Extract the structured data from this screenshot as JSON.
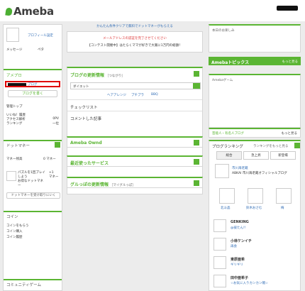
{
  "header": {
    "logo": "Ameba"
  },
  "left": {
    "profile_link": "プロフィール設定",
    "message_label": "メッセージ",
    "pega_label": "ペタ",
    "ameplo_head": "アメプロ",
    "blog_label": "ブログ",
    "write_blog_btn": "ブログを書く",
    "manage_top": "管理トップ",
    "stats": [
      {
        "label": "いいね！履歴",
        "value": ""
      },
      {
        "label": "アクセス解析",
        "value": "0PV"
      },
      {
        "label": "ランキング",
        "value": "一位"
      }
    ],
    "dotmoney_head": "ドットマネー",
    "money_owned_label": "マネー残高",
    "money_owned_value": "0 マネー",
    "puzzle_text": "パズルを1回プレイしよう\nお得なドットマネー",
    "puzzle_reward": "+1\nマネー",
    "money_receive_btn": "ドットマネーを受け取りにいく",
    "coin_head": "コイン",
    "coin_links": [
      "コインをもらう",
      "コイン購入",
      "コイン履歴"
    ],
    "community_head": "コミュニティゲーム"
  },
  "middle": {
    "promo_top": "かんたん条件クリアで無料でドットマネーがもらえる",
    "promo_red": "メールアドレスの認証を完了させてください",
    "promo_sub": "【コンテスト開催中】はたらくママが好きで大賞に1万円の総額！",
    "blog_updates_head": "ブログの更新情報",
    "blog_updates_sub": "［つながり］",
    "diet_input": "ダイエット",
    "tags": [
      "ヘアアレンジ",
      "プチプラ",
      "BBQ"
    ],
    "check_list": "チェックリスト",
    "commented": "コメントした記事",
    "ameba_ownd": "Ameba Ownd",
    "recent_service": "最近使ったサービス",
    "gurutsu_head": "グルっぽの更新情報",
    "gurutsu_sub": "［マイグルっぽ］"
  },
  "right": {
    "today_head": "本日のお楽しみ",
    "topics_head": "Amebaトピックス",
    "topics_more": "もっと見る",
    "game_head": "Amebaゲーム",
    "celeb_head": "芸能人・有名人ブログ",
    "celeb_more": "もっと見る",
    "ranking_head": "ブログランキング",
    "ranking_more": "ランキングをもっと見る",
    "tabs": [
      "総合",
      "急上昇",
      "新登場"
    ],
    "featured_name": "市川海老蔵",
    "featured_desc": "ABKAI 市川海老蔵オフィシャルブログ",
    "grid_names": [
      "北斗晶",
      "鈴木おさむ",
      "梅"
    ],
    "rank_list": [
      {
        "name": "GENKING",
        "desc": "@彼たん!!"
      },
      {
        "name": "小林ケンイチ",
        "desc": "再会"
      },
      {
        "name": "東原亜希",
        "desc": "ギリギリ"
      },
      {
        "name": "田中亜希子",
        "desc": "☆お気に入りカンカン帽☆"
      }
    ]
  },
  "colors": {
    "accent": "#5bb533",
    "alert": "#d33333"
  }
}
